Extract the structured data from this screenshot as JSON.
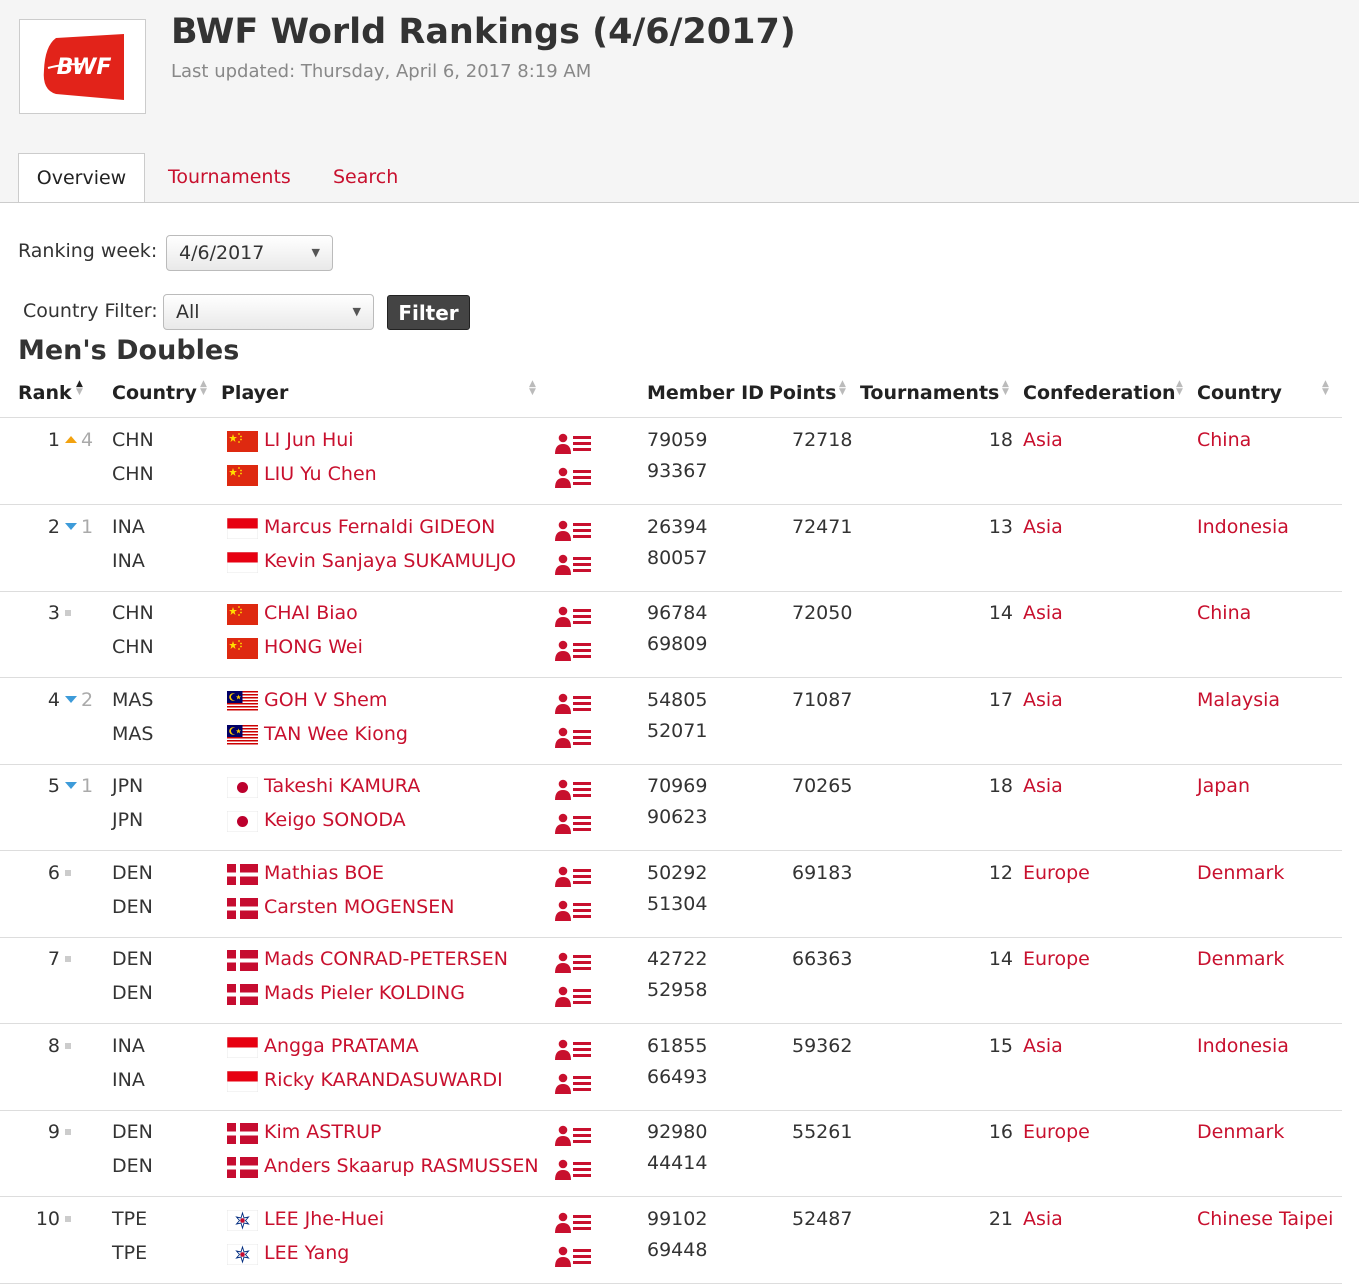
{
  "header": {
    "logo_text": "BWF",
    "title": "BWF World Rankings (4/6/2017)",
    "last_updated": "Last updated: Thursday, April 6, 2017 8:19 AM"
  },
  "tabs": [
    {
      "label": "Overview",
      "active": true
    },
    {
      "label": "Tournaments",
      "active": false
    },
    {
      "label": "Search",
      "active": false
    }
  ],
  "filters": {
    "ranking_week_label": "Ranking week:",
    "ranking_week_value": "4/6/2017",
    "country_filter_label": "Country Filter:",
    "country_filter_value": "All",
    "filter_button": "Filter"
  },
  "section_title": "Men's Doubles",
  "columns": [
    "Rank",
    "Country",
    "Player",
    "Member ID",
    "Points",
    "Tournaments",
    "Confederation",
    "Country"
  ],
  "colors": {
    "accent": "#c8102e",
    "up": "#f2a20f",
    "down": "#3d9bd9"
  },
  "icons": {
    "profile": "player-profile-icon"
  },
  "rows": [
    {
      "rank": "1",
      "move": "up",
      "move_n": "4",
      "players": [
        {
          "code": "CHN",
          "flag": "china",
          "name": "LI Jun Hui",
          "id": "79059"
        },
        {
          "code": "CHN",
          "flag": "china",
          "name": "LIU Yu Chen",
          "id": "93367"
        }
      ],
      "points": "72718",
      "tournaments": "18",
      "confederation": "Asia",
      "country": "China"
    },
    {
      "rank": "2",
      "move": "down",
      "move_n": "1",
      "players": [
        {
          "code": "INA",
          "flag": "indonesia",
          "name": "Marcus Fernaldi GIDEON",
          "id": "26394"
        },
        {
          "code": "INA",
          "flag": "indonesia",
          "name": "Kevin Sanjaya SUKAMULJO",
          "id": "80057"
        }
      ],
      "points": "72471",
      "tournaments": "13",
      "confederation": "Asia",
      "country": "Indonesia"
    },
    {
      "rank": "3",
      "move": "same",
      "move_n": "",
      "players": [
        {
          "code": "CHN",
          "flag": "china",
          "name": "CHAI Biao",
          "id": "96784"
        },
        {
          "code": "CHN",
          "flag": "china",
          "name": "HONG Wei",
          "id": "69809"
        }
      ],
      "points": "72050",
      "tournaments": "14",
      "confederation": "Asia",
      "country": "China"
    },
    {
      "rank": "4",
      "move": "down",
      "move_n": "2",
      "players": [
        {
          "code": "MAS",
          "flag": "malaysia",
          "name": "GOH V Shem",
          "id": "54805"
        },
        {
          "code": "MAS",
          "flag": "malaysia",
          "name": "TAN Wee Kiong",
          "id": "52071"
        }
      ],
      "points": "71087",
      "tournaments": "17",
      "confederation": "Asia",
      "country": "Malaysia"
    },
    {
      "rank": "5",
      "move": "down",
      "move_n": "1",
      "players": [
        {
          "code": "JPN",
          "flag": "japan",
          "name": "Takeshi KAMURA",
          "id": "70969"
        },
        {
          "code": "JPN",
          "flag": "japan",
          "name": "Keigo SONODA",
          "id": "90623"
        }
      ],
      "points": "70265",
      "tournaments": "18",
      "confederation": "Asia",
      "country": "Japan"
    },
    {
      "rank": "6",
      "move": "same",
      "move_n": "",
      "players": [
        {
          "code": "DEN",
          "flag": "denmark",
          "name": "Mathias BOE",
          "id": "50292"
        },
        {
          "code": "DEN",
          "flag": "denmark",
          "name": "Carsten MOGENSEN",
          "id": "51304"
        }
      ],
      "points": "69183",
      "tournaments": "12",
      "confederation": "Europe",
      "country": "Denmark"
    },
    {
      "rank": "7",
      "move": "same",
      "move_n": "",
      "players": [
        {
          "code": "DEN",
          "flag": "denmark",
          "name": "Mads CONRAD-PETERSEN",
          "id": "42722"
        },
        {
          "code": "DEN",
          "flag": "denmark",
          "name": "Mads Pieler KOLDING",
          "id": "52958"
        }
      ],
      "points": "66363",
      "tournaments": "14",
      "confederation": "Europe",
      "country": "Denmark"
    },
    {
      "rank": "8",
      "move": "same",
      "move_n": "",
      "players": [
        {
          "code": "INA",
          "flag": "indonesia",
          "name": "Angga PRATAMA",
          "id": "61855"
        },
        {
          "code": "INA",
          "flag": "indonesia",
          "name": "Ricky KARANDASUWARDI",
          "id": "66493"
        }
      ],
      "points": "59362",
      "tournaments": "15",
      "confederation": "Asia",
      "country": "Indonesia"
    },
    {
      "rank": "9",
      "move": "same",
      "move_n": "",
      "players": [
        {
          "code": "DEN",
          "flag": "denmark",
          "name": "Kim ASTRUP",
          "id": "92980"
        },
        {
          "code": "DEN",
          "flag": "denmark",
          "name": "Anders Skaarup RASMUSSEN",
          "id": "44414"
        }
      ],
      "points": "55261",
      "tournaments": "16",
      "confederation": "Europe",
      "country": "Denmark"
    },
    {
      "rank": "10",
      "move": "same",
      "move_n": "",
      "players": [
        {
          "code": "TPE",
          "flag": "chinese-taipei",
          "name": "LEE Jhe-Huei",
          "id": "99102"
        },
        {
          "code": "TPE",
          "flag": "chinese-taipei",
          "name": "LEE Yang",
          "id": "69448"
        }
      ],
      "points": "52487",
      "tournaments": "21",
      "confederation": "Asia",
      "country": "Chinese Taipei"
    }
  ]
}
